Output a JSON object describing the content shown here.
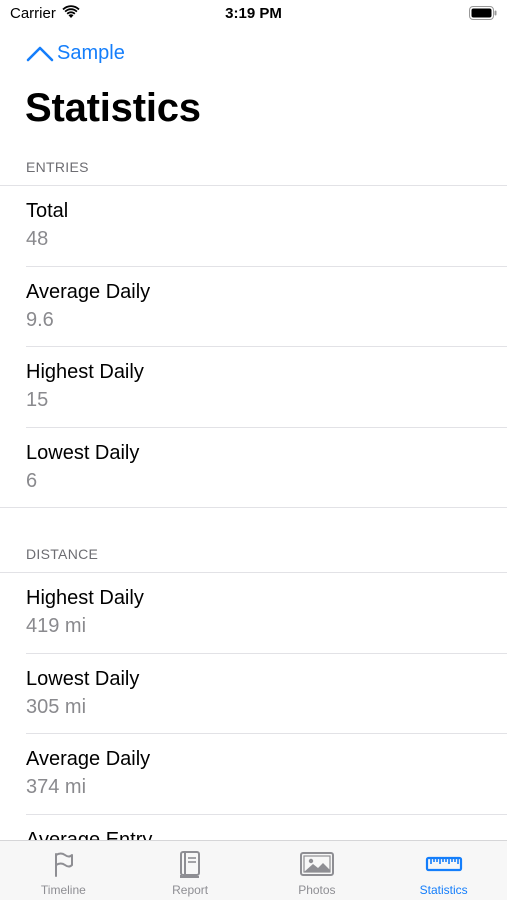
{
  "status_bar": {
    "carrier": "Carrier",
    "time": "3:19 PM"
  },
  "nav": {
    "back_label": "Sample",
    "title": "Statistics"
  },
  "sections": [
    {
      "header": "ENTRIES",
      "rows": [
        {
          "label": "Total",
          "value": "48"
        },
        {
          "label": "Average Daily",
          "value": "9.6"
        },
        {
          "label": "Highest Daily",
          "value": "15"
        },
        {
          "label": "Lowest Daily",
          "value": "6"
        }
      ]
    },
    {
      "header": "DISTANCE",
      "rows": [
        {
          "label": "Highest Daily",
          "value": "419 mi"
        },
        {
          "label": "Lowest Daily",
          "value": "305 mi"
        },
        {
          "label": "Average Daily",
          "value": "374 mi"
        },
        {
          "label": "Average Entry",
          "value": ""
        }
      ]
    }
  ],
  "tab_bar": {
    "tabs": [
      {
        "label": "Timeline",
        "icon": "flag-icon",
        "active": false
      },
      {
        "label": "Report",
        "icon": "book-icon",
        "active": false
      },
      {
        "label": "Photos",
        "icon": "photo-icon",
        "active": false
      },
      {
        "label": "Statistics",
        "icon": "ruler-icon",
        "active": true
      }
    ]
  },
  "colors": {
    "accent": "#147efb",
    "secondary_text": "#8a8a8e",
    "section_header": "#6d6d72",
    "inactive_tab": "#8e8e93"
  }
}
